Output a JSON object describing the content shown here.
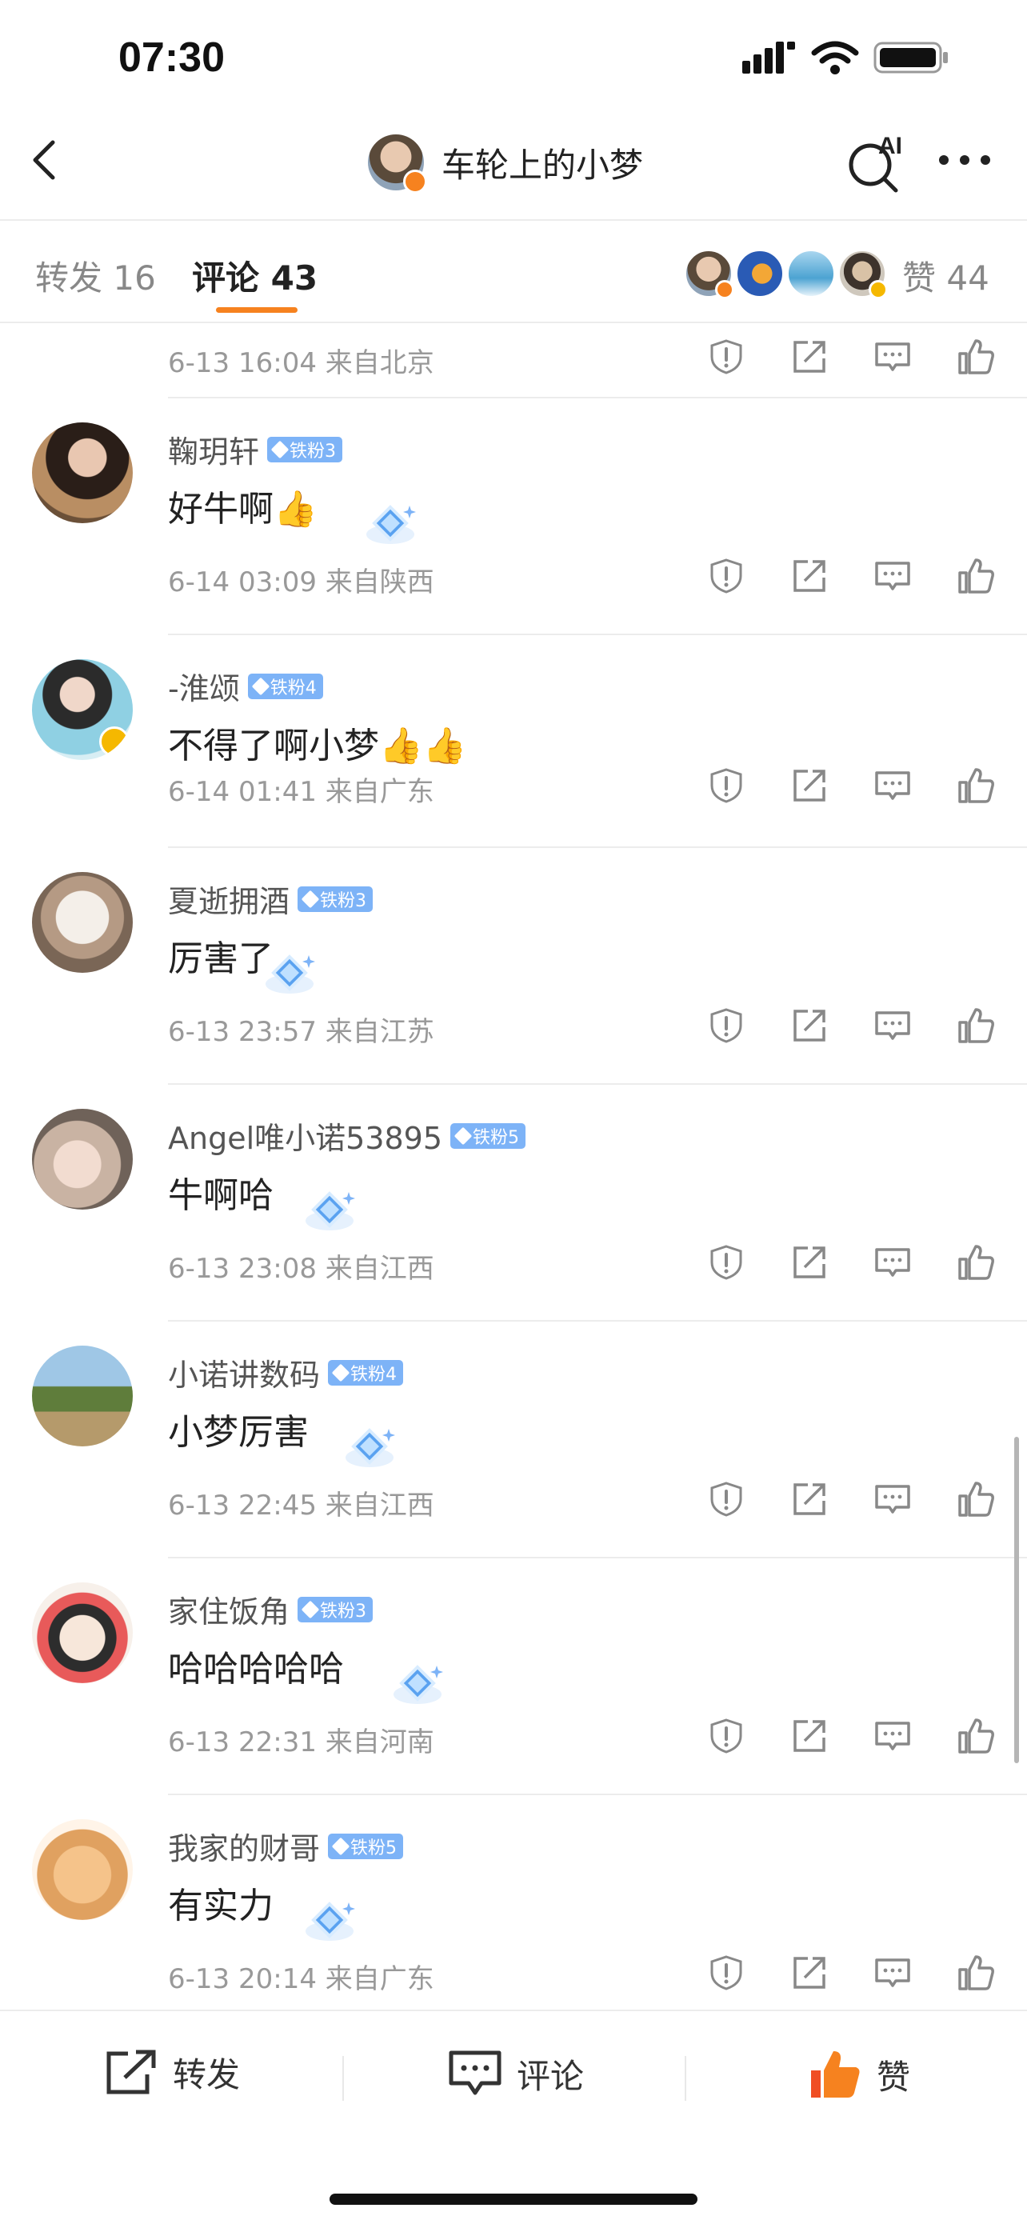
{
  "status_bar": {
    "time": "07:30"
  },
  "nav": {
    "title": "车轮上的小梦",
    "ai_label": "AI"
  },
  "tabs": {
    "repost_label": "转发",
    "repost_count": "16",
    "comment_label": "评论",
    "comment_count": "43",
    "like_label": "赞",
    "like_count": "44"
  },
  "top_meta": {
    "time": "6-13 16:04",
    "location": "来自北京"
  },
  "comments": [
    {
      "name": "鞠玥轩",
      "badge": "铁粉3",
      "text": "好牛啊👍",
      "time": "6-14 03:09",
      "location": "来自陕西",
      "verified": false
    },
    {
      "name": "-淮颂",
      "badge": "铁粉4",
      "text": "不得了啊小梦👍👍",
      "time": "6-14 01:41",
      "location": "来自广东",
      "verified": true
    },
    {
      "name": "夏逝拥酒",
      "badge": "铁粉3",
      "text": "厉害了",
      "time": "6-13 23:57",
      "location": "来自江苏",
      "verified": false
    },
    {
      "name": "Angel唯小诺53895",
      "badge": "铁粉5",
      "text": "牛啊哈",
      "time": "6-13 23:08",
      "location": "来自江西",
      "verified": false
    },
    {
      "name": "小诺讲数码",
      "badge": "铁粉4",
      "text": "小梦厉害",
      "time": "6-13 22:45",
      "location": "来自江西",
      "verified": false
    },
    {
      "name": "家住饭角",
      "badge": "铁粉3",
      "text": "哈哈哈哈哈",
      "time": "6-13 22:31",
      "location": "来自河南",
      "verified": false
    },
    {
      "name": "我家的财哥",
      "badge": "铁粉5",
      "text": "有实力",
      "time": "6-13 20:14",
      "location": "来自广东",
      "verified": false
    }
  ],
  "bottom_bar": {
    "repost": "转发",
    "comment": "评论",
    "like": "赞"
  },
  "colors": {
    "accent": "#f6821f",
    "fan_badge": "#7db3f7",
    "meta_text": "#999999"
  }
}
